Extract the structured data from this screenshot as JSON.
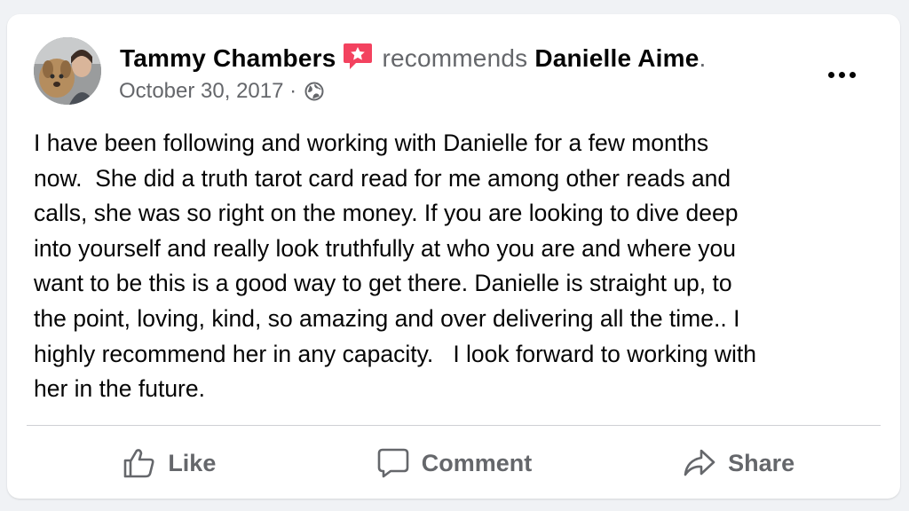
{
  "post": {
    "author": "Tammy Chambers",
    "verb": "recommends",
    "target": "Danielle Aime",
    "target_suffix": ".",
    "date": "October 30, 2017",
    "separator": " · ",
    "body": "I have been following and working with Danielle for a few months\nnow.  She did a truth tarot card read for me among other reads and\ncalls, she was so right on the money. If you are looking to dive deep\ninto yourself and really look truthfully at who you are and where you\nwant to be this is a good way to get there. Danielle is straight up, to\nthe point, loving, kind, so amazing and over delivering all the time.. I\nhighly recommend her in any capacity.   I look forward to working with\nher in the future."
  },
  "actions": {
    "like": "Like",
    "comment": "Comment",
    "share": "Share"
  },
  "icons": {
    "avatar": "avatar-photo",
    "recommend_badge": "recommend-star-badge-icon",
    "audience": "globe-icon",
    "more": "more-options-icon",
    "like": "thumbs-up-icon",
    "comment": "comment-bubble-icon",
    "share": "share-arrow-icon"
  },
  "colors": {
    "background": "#f0f2f5",
    "card": "#ffffff",
    "primary_text": "#050505",
    "secondary_text": "#65676b",
    "badge": "#f3425f",
    "divider": "#ced0d4"
  }
}
